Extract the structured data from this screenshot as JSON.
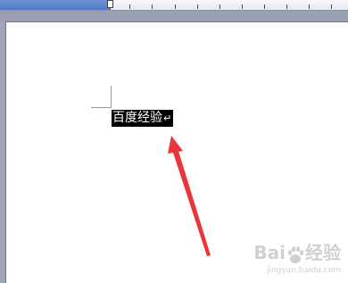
{
  "document": {
    "selected_text": "百度经验",
    "paragraph_mark": "↵"
  },
  "watermark": {
    "brand_left": "Bai",
    "brand_right": "经验",
    "url": "jingyan.baidu.com"
  },
  "colors": {
    "annotation_arrow": "#e8363b",
    "selection_background": "#000000",
    "ruler_active": "#5a82cc"
  },
  "icons": {
    "ruler_indent_marker": "indent-marker-icon",
    "watermark_logo": "paw-icon"
  }
}
